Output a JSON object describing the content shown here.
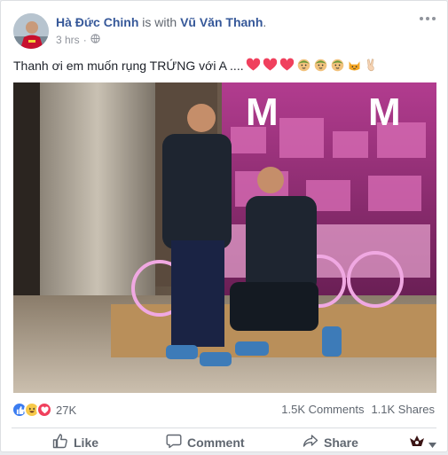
{
  "post": {
    "author": "Hà Đức Chinh",
    "with_text": " is with ",
    "tagged": "Vũ Văn Thanh",
    "period": ".",
    "time": "3 hrs",
    "dot": "·",
    "text": "Thanh ơi em muốn rụng TRỨNG với A ....",
    "emojis": [
      "heart",
      "heart",
      "heart",
      "face-baby",
      "face-baby",
      "face-baby",
      "cat-face",
      "victory-hand"
    ]
  },
  "stats": {
    "reactions_count": "27K",
    "comments": "1.5K Comments",
    "shares": "1.1K Shares",
    "reactions": [
      "like",
      "haha",
      "love"
    ]
  },
  "actions": {
    "like": "Like",
    "comment": "Comment",
    "share": "Share"
  },
  "colors": {
    "link": "#365899",
    "like_blue": "#3b7cf0",
    "love_red": "#f0405d",
    "haha_yellow": "#f7c94a"
  }
}
